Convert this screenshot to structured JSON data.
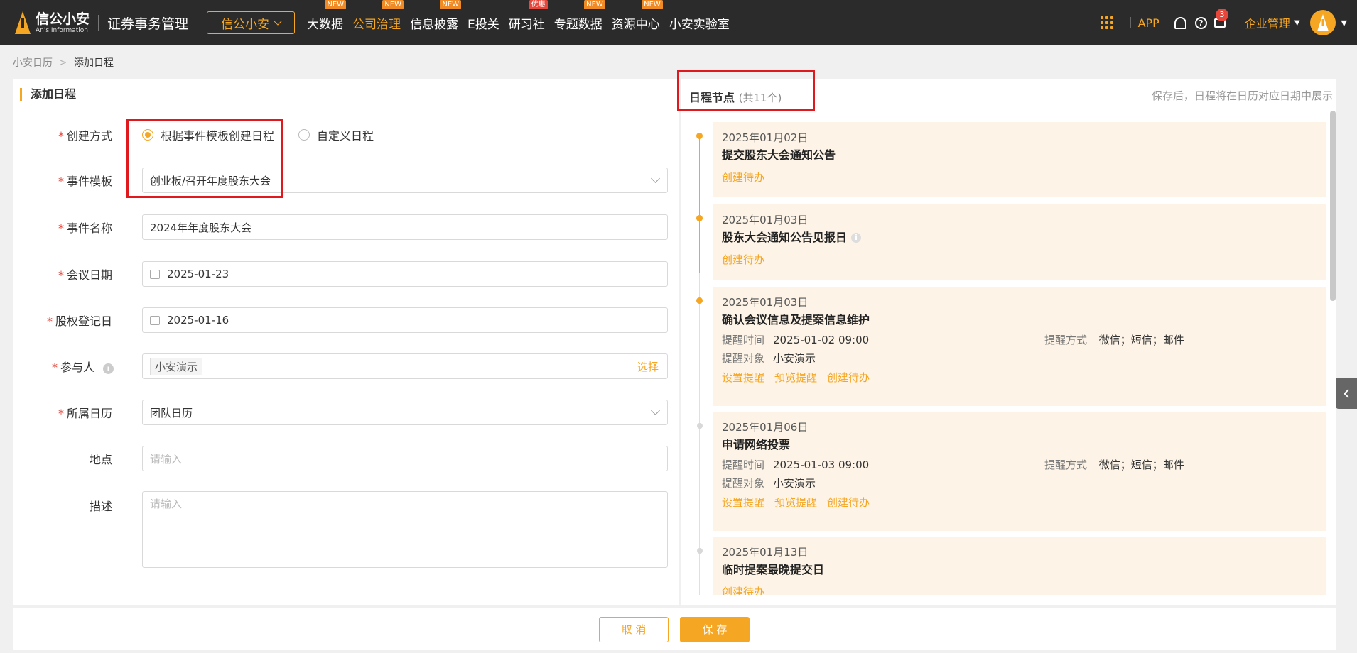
{
  "header": {
    "logo_cn": "信公小安",
    "logo_en": "An's Information",
    "system_name": "证券事务管理",
    "brand_button": "信公小安",
    "nav": [
      {
        "label": "大数据",
        "badge": "NEW",
        "badge_color": "#f08a24"
      },
      {
        "label": "公司治理",
        "badge": "NEW",
        "badge_color": "#f08a24",
        "active": true
      },
      {
        "label": "信息披露",
        "badge": "NEW",
        "badge_color": "#f08a24"
      },
      {
        "label": "E投关",
        "badge": ""
      },
      {
        "label": "研习社",
        "badge": "优惠",
        "badge_color": "#e8463a"
      },
      {
        "label": "专题数据",
        "badge": "NEW",
        "badge_color": "#f08a24"
      },
      {
        "label": "资源中心",
        "badge": "NEW",
        "badge_color": "#f08a24"
      },
      {
        "label": "小安实验室",
        "badge": ""
      }
    ],
    "app_label": "APP",
    "message_count": "3",
    "org_menu": "企业管理"
  },
  "breadcrumb": {
    "root": "小安日历",
    "current": "添加日程"
  },
  "form": {
    "title": "添加日程",
    "create_mode_label": "创建方式",
    "create_mode_options": [
      "根据事件模板创建日程",
      "自定义日程"
    ],
    "template_label": "事件模板",
    "template_value": "创业板/召开年度股东大会",
    "event_name_label": "事件名称",
    "event_name_value": "2024年年度股东大会",
    "meeting_date_label": "会议日期",
    "meeting_date_value": "2025-01-23",
    "record_date_label": "股权登记日",
    "record_date_value": "2025-01-16",
    "participants_label": "参与人",
    "participant_tag": "小安演示",
    "select_link": "选择",
    "calendar_label": "所属日历",
    "calendar_value": "团队日历",
    "location_label": "地点",
    "location_placeholder": "请输入",
    "desc_label": "描述",
    "desc_placeholder": "请输入"
  },
  "schedule": {
    "title": "日程节点",
    "count": "(共11个)",
    "hint": "保存后，日程将在日历对应日期中展示",
    "nodes": [
      {
        "date": "2025年01月02日",
        "title": "提交股东大会通知公告",
        "action1": "创建待办"
      },
      {
        "date": "2025年01月03日",
        "title": "股东大会通知公告见报日",
        "action1": "创建待办"
      },
      {
        "date": "2025年01月03日",
        "title": "确认会议信息及提案信息维护",
        "remind_time_label": "提醒时间",
        "remind_time": "2025-01-02 09:00",
        "remind_method_label": "提醒方式",
        "remind_method": "微信；短信；邮件",
        "remind_target_label": "提醒对象",
        "remind_target": "小安演示",
        "action1": "设置提醒",
        "action2": "预览提醒",
        "action3": "创建待办"
      },
      {
        "date": "2025年01月06日",
        "title": "申请网络投票",
        "remind_time_label": "提醒时间",
        "remind_time": "2025-01-03 09:00",
        "remind_method_label": "提醒方式",
        "remind_method": "微信；短信；邮件",
        "remind_target_label": "提醒对象",
        "remind_target": "小安演示",
        "action1": "设置提醒",
        "action2": "预览提醒",
        "action3": "创建待办"
      },
      {
        "date": "2025年01月13日",
        "title": "临时提案最晚提交日",
        "action1": "创建待办"
      }
    ]
  },
  "footer": {
    "cancel": "取 消",
    "save": "保 存"
  },
  "colors": {
    "accent": "#f5a623",
    "highlight_box": "#e0191f"
  }
}
